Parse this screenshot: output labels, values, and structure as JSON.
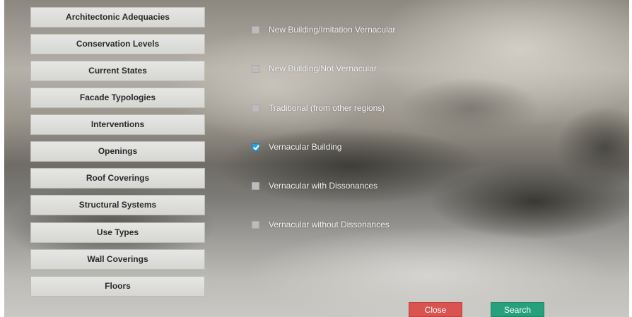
{
  "categories": [
    {
      "label": "Architectonic Adequacies"
    },
    {
      "label": "Conservation Levels"
    },
    {
      "label": "Current States"
    },
    {
      "label": "Facade Typologies"
    },
    {
      "label": "Interventions"
    },
    {
      "label": "Openings"
    },
    {
      "label": "Roof Coverings"
    },
    {
      "label": "Structural Systems"
    },
    {
      "label": "Use Types"
    },
    {
      "label": "Wall Coverings"
    },
    {
      "label": "Floors"
    }
  ],
  "options": [
    {
      "label": "New Building/Imitation Vernacular",
      "checked": false
    },
    {
      "label": "New Building/Not Vernacular",
      "checked": false
    },
    {
      "label": "Traditional (from other regions)",
      "checked": false
    },
    {
      "label": "Vernacular Building",
      "checked": true
    },
    {
      "label": "Vernacular with Dissonances",
      "checked": false
    },
    {
      "label": "Vernacular without Dissonances",
      "checked": false
    }
  ],
  "actions": {
    "close_label": "Close",
    "search_label": "Search"
  },
  "colors": {
    "close": "#d9534f",
    "search": "#26a17c",
    "checkbox_checked": "#2f9fd6",
    "checkbox_unchecked": "#bcbcbc"
  }
}
